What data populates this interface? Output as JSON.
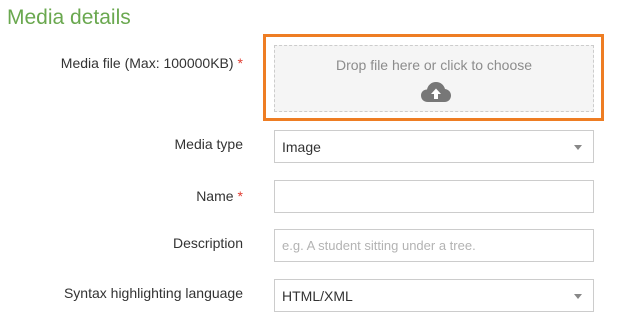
{
  "section": {
    "title": "Media details"
  },
  "media_file": {
    "label": "Media file (Max: 100000KB)",
    "required_marker": "*",
    "dropzone_text": "Drop file here or click to choose",
    "icon": "cloud-upload-icon",
    "highlight_color": "#ee7d23"
  },
  "media_type": {
    "label": "Media type",
    "value": "Image"
  },
  "name": {
    "label": "Name",
    "required_marker": "*",
    "value": ""
  },
  "description": {
    "label": "Description",
    "placeholder": "e.g. A student sitting under a tree."
  },
  "syntax": {
    "label": "Syntax highlighting language",
    "value": "HTML/XML"
  },
  "colors": {
    "title_green": "#6aa84f",
    "required_red": "#e03a2f"
  }
}
